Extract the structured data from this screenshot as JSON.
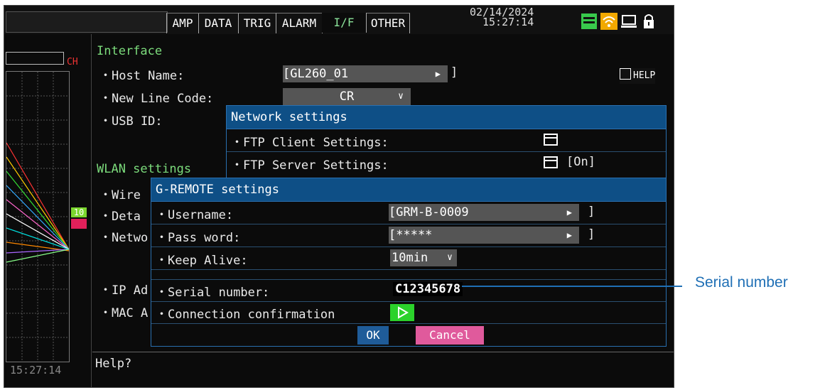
{
  "tabs": [
    "AMP",
    "DATA",
    "TRIG",
    "ALARM",
    "I/F",
    "OTHER"
  ],
  "active_tab": "I/F",
  "datetime": {
    "date": "02/14/2024",
    "time": "15:27:14"
  },
  "status_icons": [
    "memory-icon",
    "wifi-icon",
    "pc-connection-icon",
    "lock-icon"
  ],
  "left_panel": {
    "ch_label": "CH",
    "time": "15:27:14",
    "badge": "10"
  },
  "interface": {
    "section_title": "Interface",
    "host_name_label": "・Host Name:",
    "host_name_value": "[GL260_01",
    "host_name_close": "]",
    "new_line_label": "・New Line Code:",
    "new_line_value": "CR",
    "usb_id_label": "・USB ID:",
    "help_button": "HELP"
  },
  "wlan": {
    "section_title": "WLAN settings",
    "wire_label": "・Wire",
    "data_label": "・Deta",
    "network_label": "・Netwo",
    "ip_label": "・IP Ad",
    "mac_label": "・MAC A"
  },
  "network_dialog": {
    "title": "Network settings",
    "ftp_client_label": "・FTP Client Settings:",
    "ftp_server_label": "・FTP Server Settings:",
    "ftp_server_status": "[On]"
  },
  "gremote_dialog": {
    "title": "G-REMOTE settings",
    "username_label": "・Username:",
    "username_value": "[GRM-B-0009",
    "password_label": "・Pass word:",
    "password_value": "[*****",
    "keep_alive_label": "・Keep Alive:",
    "keep_alive_value": "10min",
    "serial_label": "・Serial number:",
    "serial_value": "C12345678",
    "connection_label": "・Connection confirmation",
    "ok_label": "OK",
    "cancel_label": "Cancel"
  },
  "help_text": "Help?",
  "callout": "Serial number",
  "colors": {
    "accent_blue": "#0e4f86",
    "active_tab_green": "#8be39a",
    "ok_button": "#1f5c99",
    "cancel_button": "#e05a9c",
    "callout": "#1f6fb5"
  }
}
